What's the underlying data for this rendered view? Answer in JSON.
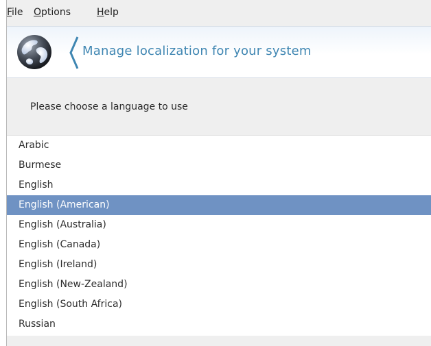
{
  "menubar": {
    "items": [
      {
        "mnemonic": "F",
        "rest": "ile"
      },
      {
        "mnemonic": "O",
        "rest": "ptions"
      },
      {
        "mnemonic": "H",
        "rest": "elp"
      }
    ]
  },
  "banner": {
    "title": "Manage localization for your system",
    "icon": "globe-icon",
    "accent_color": "#3f86b2"
  },
  "prompt": "Please choose a language to use",
  "languages": {
    "items": [
      "Arabic",
      "Burmese",
      "English",
      "English (American)",
      "English (Australia)",
      "English (Canada)",
      "English (Ireland)",
      "English (New-Zealand)",
      "English (South Africa)",
      "Russian"
    ],
    "selected": "English (American)",
    "selection_color": "#6f92c3"
  }
}
